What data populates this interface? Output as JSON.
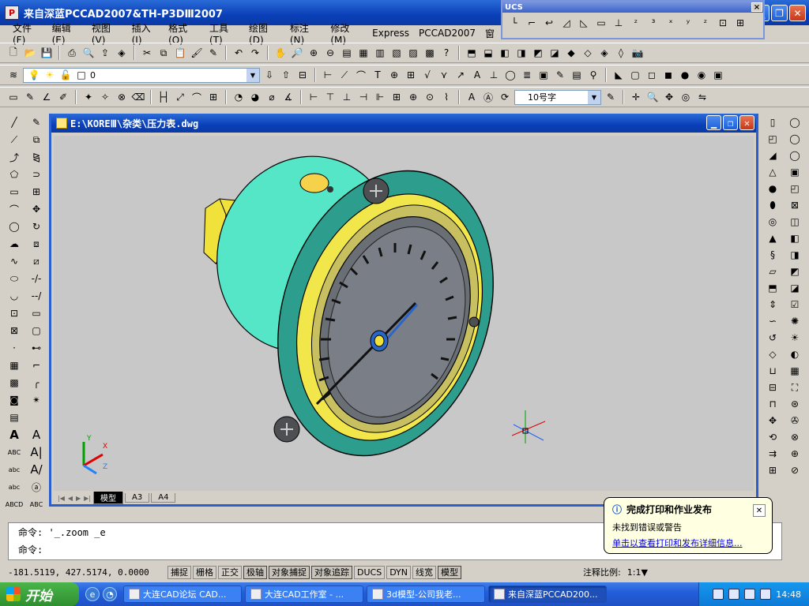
{
  "app": {
    "title": "来自深蓝PCCAD2007&TH-P3DⅢ2007",
    "icon_glyph": "P"
  },
  "menu": [
    "文件(F)",
    "编辑(E)",
    "视图(V)",
    "插入(I)",
    "格式(O)",
    "工具(T)",
    "绘图(D)",
    "标注(N)",
    "修改(M)",
    "Express",
    "PCCAD2007",
    "窗"
  ],
  "ucs_toolbar": {
    "title": "UCS",
    "close": "×"
  },
  "layer": {
    "current": "0",
    "dropdown_arrow": "▼"
  },
  "text_style": {
    "value": "10号字"
  },
  "document": {
    "title": "E:\\KOREⅢ\\杂类\\压力表.dwg"
  },
  "tabs": [
    "模型",
    "A3",
    "A4"
  ],
  "tab_nav": [
    "|◀",
    "◀",
    "▶",
    "▶|"
  ],
  "axis_labels": {
    "x": "X",
    "y": "Y",
    "z": "Z"
  },
  "command": {
    "line1": "命令: '_.zoom _e",
    "line2": "命令:"
  },
  "status": {
    "coords": "-181.5119, 427.5174, 0.0000",
    "toggles": [
      "捕捉",
      "栅格",
      "正交",
      "极轴",
      "对象捕捉",
      "对象追踪",
      "DUCS",
      "DYN",
      "线宽",
      "模型"
    ],
    "annotation_scale_label": "注释比例:",
    "annotation_scale_value": "1:1▼"
  },
  "balloon": {
    "title": "完成打印和作业发布",
    "message": "未找到错误或警告",
    "link": "单击以查看打印和发布详细信息..."
  },
  "taskbar": {
    "start": "开始",
    "tasks": [
      "大连CAD论坛 CAD...",
      "大连CAD工作室 - ...",
      "3d模型-公司我老...",
      "来自深蓝PCCAD200..."
    ],
    "clock": "14:48"
  }
}
